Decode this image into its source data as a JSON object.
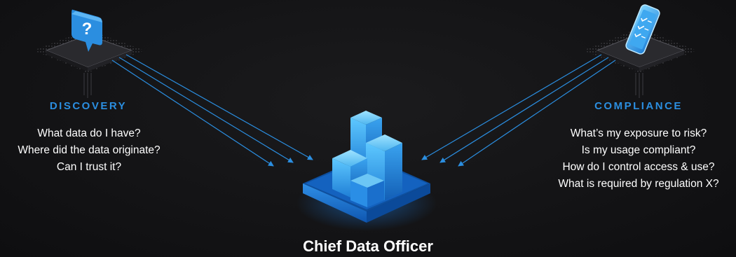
{
  "accent_color": "#2b8ee0",
  "text_color": "#ffffff",
  "discovery": {
    "heading": "DISCOVERY",
    "icon": "question-bubble-icon",
    "questions": [
      "What data do I have?",
      "Where did the data originate?",
      "Can I trust it?"
    ]
  },
  "compliance": {
    "heading": "COMPLIANCE",
    "icon": "smartphone-checklist-icon",
    "questions": [
      "What’s my exposure to risk?",
      "Is my usage compliant?",
      "How do I control access & use?",
      "What is required by regulation X?"
    ]
  },
  "center": {
    "title": "Chief Data Officer",
    "icon": "data-buildings-icon"
  }
}
